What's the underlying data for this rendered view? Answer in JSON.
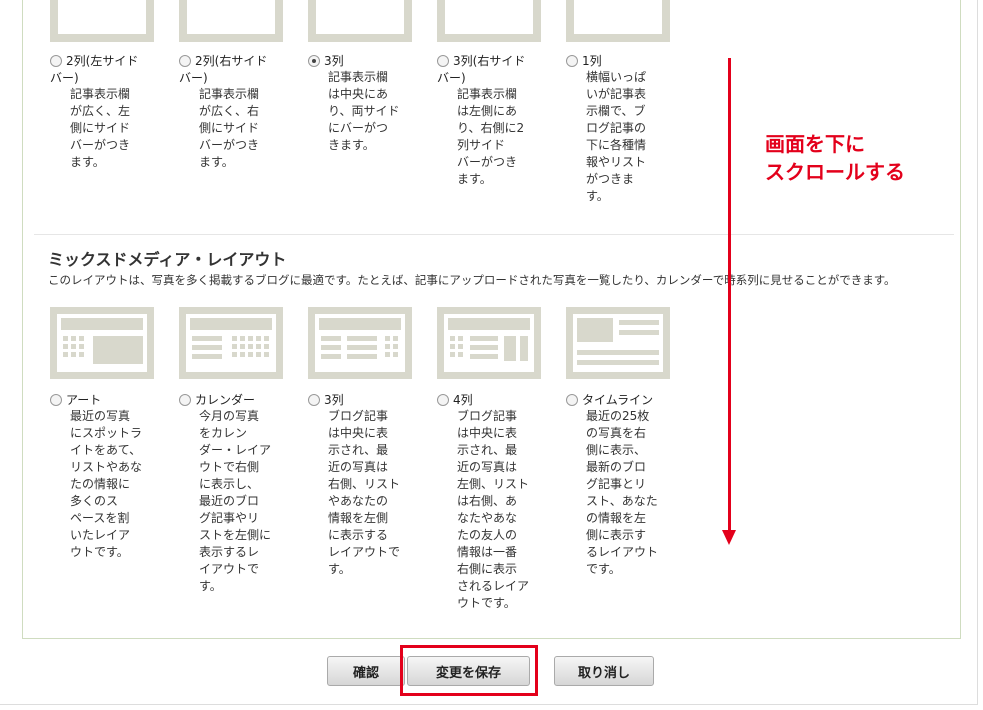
{
  "colors": {
    "accent": "#e3001b",
    "thumb": "#d8d8cc",
    "panel_border": "#cfdcc0"
  },
  "top_options": [
    {
      "label": "2列(左サイド",
      "label2": "バー)",
      "desc": "記事表示欄\nが広く、左\n側にサイド\nバーがつき\nます。",
      "checked": false
    },
    {
      "label": "2列(右サイド",
      "label2": "バー)",
      "desc": "記事表示欄\nが広く、右\n側にサイド\nバーがつき\nます。",
      "checked": false
    },
    {
      "label": "3列",
      "label2": "",
      "desc": "記事表示欄\nは中央にあ\nり、両サイド\nにバーがつ\nきます。",
      "checked": true
    },
    {
      "label": "3列(右サイド",
      "label2": "バー)",
      "desc": "記事表示欄\nは左側にあ\nり、右側に2\n列サイド\nバーがつき\nます。",
      "checked": false
    },
    {
      "label": "1列",
      "label2": "",
      "desc": "横幅いっぱ\nいが記事表\n示欄で、ブ\nログ記事の\n下に各種情\n報やリスト\nがつきま\nす。",
      "checked": false
    }
  ],
  "mixed": {
    "heading": "ミックスドメディア・レイアウト",
    "description": "このレイアウトは、写真を多く掲載するブログに最適です。たとえば、記事にアップロードされた写真を一覧したり、カレンダーで時系列に見せることができます。",
    "options": [
      {
        "label": "アート",
        "desc": "最近の写真\nにスポットラ\nイトをあて、\nリストやあな\nたの情報に\n多くのス\nペースを割\nいたレイア\nウトです。"
      },
      {
        "label": "カレンダー",
        "desc": "今月の写真\nをカレン\nダー・レイア\nウトで右側\nに表示し、\n最近のブロ\nグ記事やリ\nストを左側に\n表示するレ\nイアウトで\nす。"
      },
      {
        "label": "3列",
        "desc": "ブログ記事\nは中央に表\n示され、最\n近の写真は\n右側、リスト\nやあなたの\n情報を左側\nに表示する\nレイアウトで\nす。"
      },
      {
        "label": "4列",
        "desc": "ブログ記事\nは中央に表\n示され、最\n近の写真は\n左側、リスト\nは右側、あ\nなたやあな\nたの友人の\n情報は一番\n右側に表示\nされるレイア\nウトです。"
      },
      {
        "label": "タイムライン",
        "desc": "最近の25枚\nの写真を右\n側に表示、\n最新のブロ\nグ記事とリ\nスト、あなた\nの情報を左\n側に表示す\nるレイアウト\nです。"
      }
    ]
  },
  "buttons": {
    "confirm": "確認",
    "save": "変更を保存",
    "cancel": "取り消し"
  },
  "annotation": {
    "line1": "画面を下に",
    "line2": "スクロールする"
  }
}
